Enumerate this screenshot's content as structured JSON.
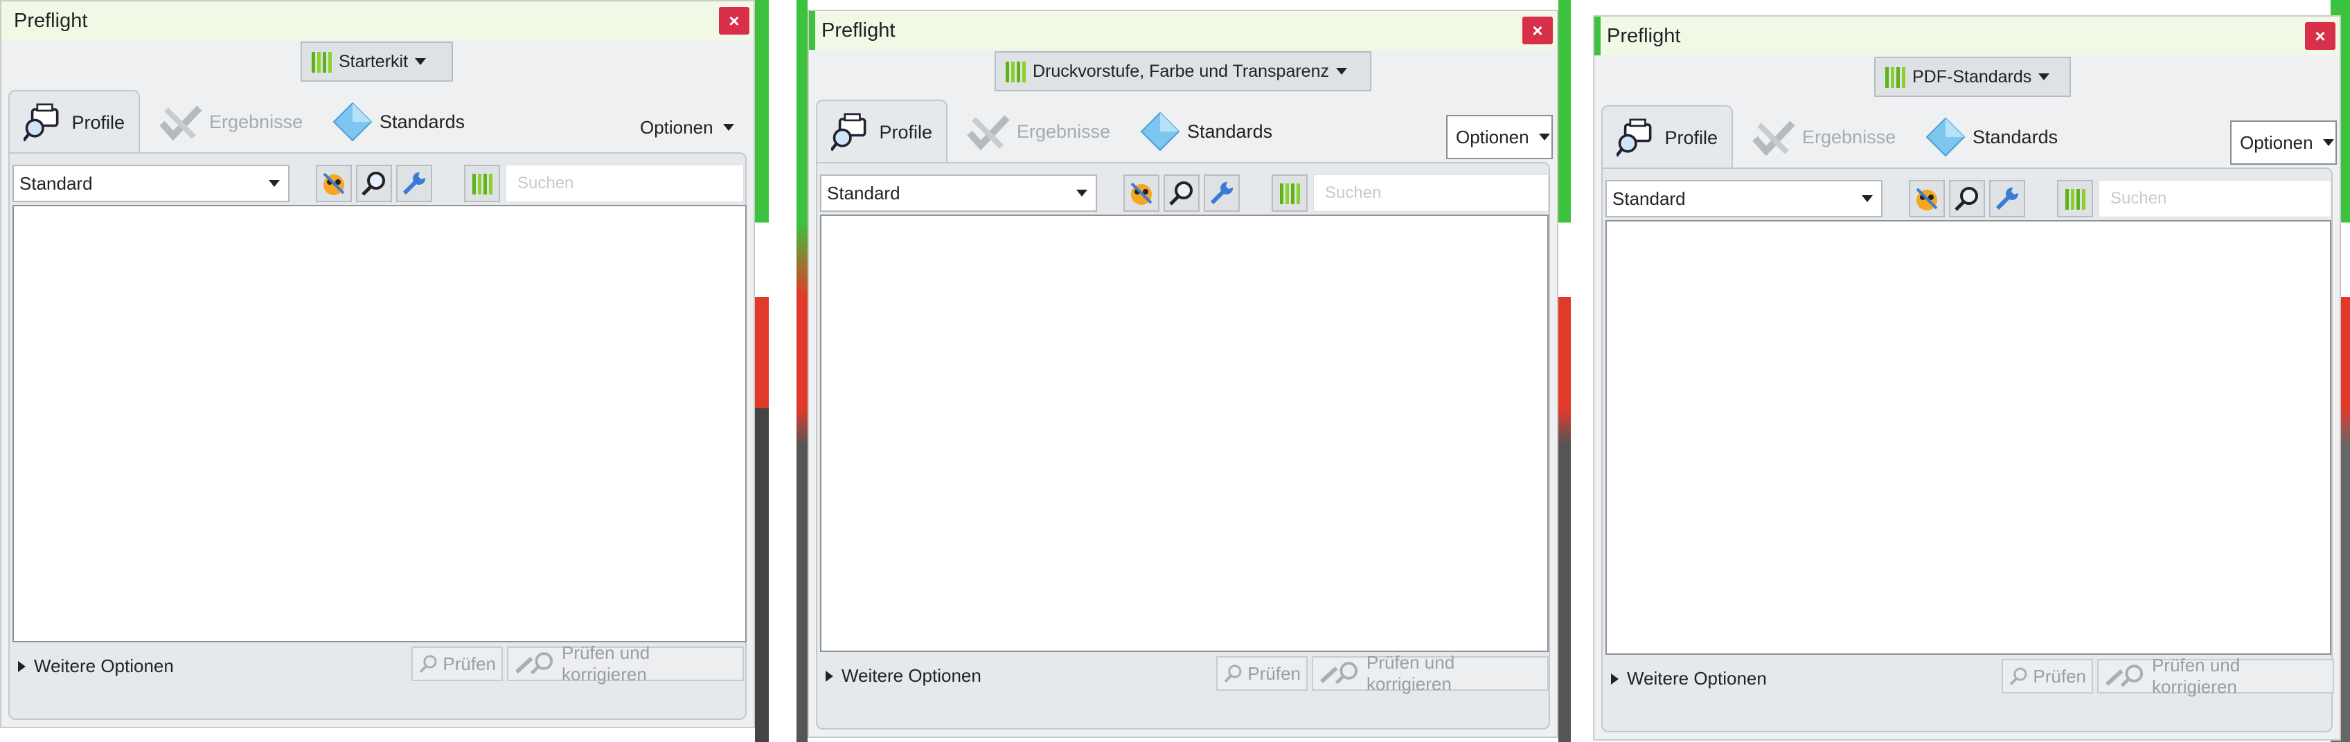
{
  "colors": {
    "close": "#d9304a",
    "title_bar": "#f1f8e6",
    "accent_green": "#3cc23c",
    "kit_icon_green": "#8bd12a"
  },
  "panels": [
    {
      "title": "Preflight",
      "close_label": "×",
      "kit_label": "Starterkit",
      "tabs": [
        "Profile",
        "Ergebnisse",
        "Standards"
      ],
      "options_label": "Optionen",
      "profile_select": "Standard",
      "search_placeholder": "Suchen",
      "more_options": "Weitere Optionen",
      "check_label": "Prüfen",
      "check_fix_label": "Prüfen und korrigieren"
    },
    {
      "title": "Preflight",
      "close_label": "×",
      "kit_label": "Druckvorstufe, Farbe und Transparenz",
      "tabs": [
        "Profile",
        "Ergebnisse",
        "Standards"
      ],
      "options_label": "Optionen",
      "profile_select": "Standard",
      "search_placeholder": "Suchen",
      "more_options": "Weitere Optionen",
      "check_label": "Prüfen",
      "check_fix_label": "Prüfen und korrigieren"
    },
    {
      "title": "Preflight",
      "close_label": "×",
      "kit_label": "PDF-Standards",
      "tabs": [
        "Profile",
        "Ergebnisse",
        "Standards"
      ],
      "options_label": "Optionen",
      "profile_select": "Standard",
      "search_placeholder": "Suchen",
      "more_options": "Weitere Optionen",
      "check_label": "Prüfen",
      "check_fix_label": "Prüfen und korrigieren"
    }
  ]
}
